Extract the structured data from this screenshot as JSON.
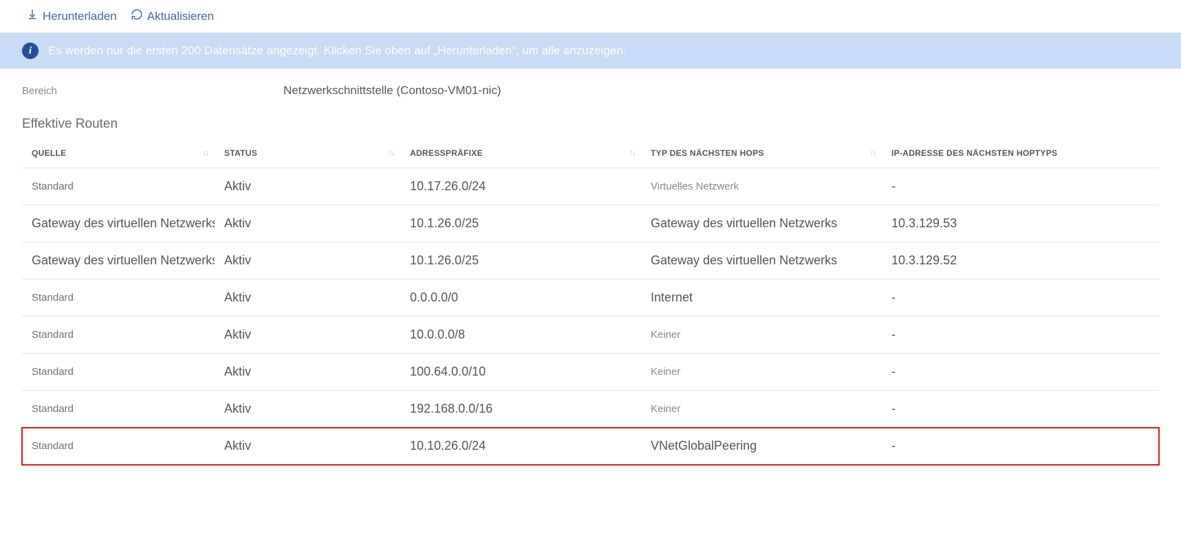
{
  "toolbar": {
    "download_label": "Herunterladen",
    "refresh_label": "Aktualisieren"
  },
  "banner": {
    "text": "Es werden nur die ersten 200 Datensätze angezeigt. Klicken Sie oben auf „Herunterladen\", um alle anzuzeigen."
  },
  "scope": {
    "label": "Bereich",
    "value": "Netzwerkschnittstelle (Contoso-VM01-nic)"
  },
  "section_title": "Effektive Routen",
  "columns": {
    "source": "QUELLE",
    "status": "STATUS",
    "prefixes": "ADRESSPRÄFIXE",
    "nexthop_type": "TYP DES NÄCHSTEN HOPS",
    "nexthop_ip": "IP-ADRESSE DES NÄCHSTEN HOPTYPS"
  },
  "rows": [
    {
      "source": "Standard",
      "status": "Aktiv",
      "prefix": "10.17.26.0/24",
      "hop": "Virtuelles Netzwerk",
      "ip": "-",
      "src_style": "small",
      "hop_style": "dim"
    },
    {
      "source": "Gateway des virtuellen Netzwerks",
      "status": "Aktiv",
      "prefix": "10.1.26.0/25",
      "hop": "Gateway des virtuellen Netzwerks",
      "ip": "10.3.129.53",
      "src_style": "big",
      "hop_style": "big"
    },
    {
      "source": "Gateway des virtuellen Netzwerks",
      "status": "Aktiv",
      "prefix": "10.1.26.0/25",
      "hop": "Gateway des virtuellen Netzwerks",
      "ip": "10.3.129.52",
      "src_style": "big",
      "hop_style": "big"
    },
    {
      "source": "Standard",
      "status": "Aktiv",
      "prefix": "0.0.0.0/0",
      "hop": "Internet",
      "ip": "-",
      "src_style": "small",
      "hop_style": "big"
    },
    {
      "source": "Standard",
      "status": "Aktiv",
      "prefix": "10.0.0.0/8",
      "hop": "Keiner",
      "ip": "-",
      "src_style": "small",
      "hop_style": "dim"
    },
    {
      "source": "Standard",
      "status": "Aktiv",
      "prefix": "100.64.0.0/10",
      "hop": "Keiner",
      "ip": "-",
      "src_style": "small",
      "hop_style": "dim"
    },
    {
      "source": "Standard",
      "status": "Aktiv",
      "prefix": "192.168.0.0/16",
      "hop": "Keiner",
      "ip": "-",
      "src_style": "small",
      "hop_style": "dim"
    },
    {
      "source": "Standard",
      "status": "Aktiv",
      "prefix": "10.10.26.0/24",
      "hop": "VNetGlobalPeering",
      "ip": "-",
      "src_style": "small",
      "hop_style": "big",
      "highlight": true
    }
  ]
}
